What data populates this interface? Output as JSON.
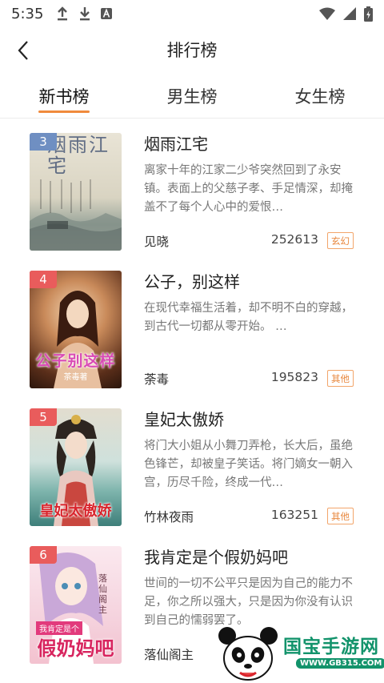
{
  "status_bar": {
    "time": "5:35",
    "left_icons": [
      "upload-icon",
      "download-icon",
      "a-badge-icon"
    ],
    "right_icons": [
      "wifi-icon",
      "signal-icon",
      "battery-charging-icon"
    ]
  },
  "nav": {
    "title": "排行榜"
  },
  "tabs": [
    {
      "label": "新书榜",
      "active": true
    },
    {
      "label": "男生榜",
      "active": false
    },
    {
      "label": "女生榜",
      "active": false
    }
  ],
  "books": [
    {
      "rank": "3",
      "rank_color": "#6f8fc2",
      "title": "烟雨江宅",
      "cover_title": "烟雨江宅",
      "desc": "离家十年的江家二少爷突然回到了永安镇。表面上的父慈子孝、手足情深，却掩盖不了每个人心中的爱恨…",
      "author": "见晓",
      "count": "252613",
      "tag": "玄幻"
    },
    {
      "rank": "4",
      "rank_color": "#e95c5c",
      "title": "公子，别这样",
      "cover_title": "公子别这样",
      "cover_sub": "茶毒著",
      "desc": "在现代幸福生活着，却不明不白的穿越，到古代一切都从零开始。 …",
      "author": "荼毒",
      "count": "195823",
      "tag": "其他"
    },
    {
      "rank": "5",
      "rank_color": "#e95c5c",
      "title": "皇妃太傲娇",
      "cover_title": "皇妃太傲娇",
      "desc": "将门大小姐从小舞刀弄枪，长大后，虽绝色锋芒，却被皇子笑话。将门嫡女一朝入宫，历尽千险，终成一代…",
      "author": "竹林夜雨",
      "count": "163251",
      "tag": "其他"
    },
    {
      "rank": "6",
      "rank_color": "#e95c5c",
      "title": "我肯定是个假奶妈吧",
      "cover_title": "假奶妈吧",
      "cover_banner": "我肯定是个",
      "cover_author": "落仙阁主",
      "desc": "世间的一切不公平只是因为自己的能力不足，你之所以强大，只是因为你没有认识到自己的懦弱罢了。",
      "author": "落仙阁主",
      "count": "",
      "tag": ""
    }
  ],
  "watermark": {
    "brand": "国宝手游网",
    "url": "WWW.GB315.COM"
  },
  "colors": {
    "accent": "#f08a3c",
    "tag": "#e8883f"
  }
}
